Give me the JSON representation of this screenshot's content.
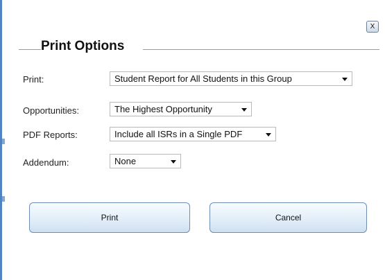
{
  "dialog": {
    "title": "Print Options",
    "close_label": "X"
  },
  "fields": {
    "print": {
      "label": "Print:",
      "value": "Student Report for All Students in this Group"
    },
    "opportunities": {
      "label": "Opportunities:",
      "value": "The Highest Opportunity"
    },
    "pdf_reports": {
      "label": "PDF Reports:",
      "value": "Include all ISRs in a Single PDF"
    },
    "addendum": {
      "label": "Addendum:",
      "value": "None"
    }
  },
  "buttons": {
    "print_label": "Print",
    "cancel_label": "Cancel"
  },
  "icons": {
    "close": "close-icon",
    "dropdown": "chevron-down-icon"
  },
  "colors": {
    "button_border": "#6d8eb4",
    "button_fill": "#e3eef9",
    "window_edge": "#4f83c2"
  }
}
